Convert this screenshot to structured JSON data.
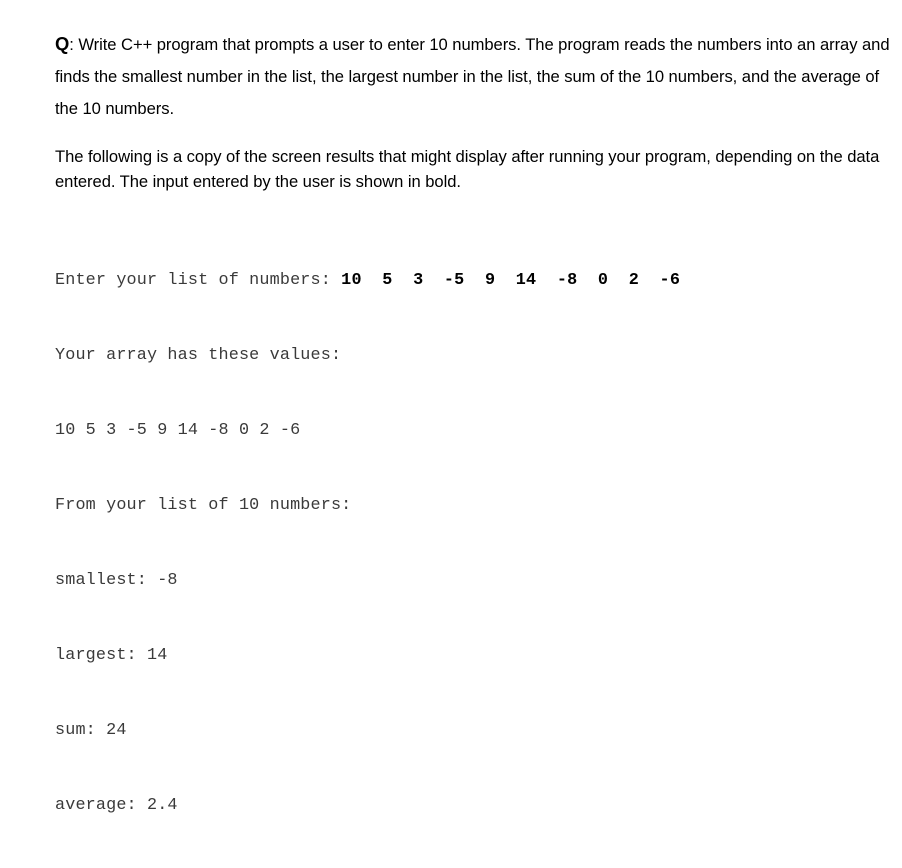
{
  "document": {
    "background_color": "#ffffff",
    "text_color": "#000000",
    "console_text_color": "#3a3a3a"
  },
  "question": {
    "label": "Q",
    "separator": ": ",
    "body": "Write C++ program that prompts a user to enter 10 numbers. The program reads the numbers into an array and finds the smallest number in the list, the largest number in the list, the sum of the 10 numbers, and the average of the 10 numbers."
  },
  "intro": {
    "text": "The following is a copy of the screen results that might display after running your program, depending on the data entered. The input entered by the user is shown in bold."
  },
  "console": {
    "prompt_line": {
      "prompt": "Enter your list of numbers: ",
      "user_input": "10  5  3  -5  9  14  -8  0  2  -6"
    },
    "lines": [
      "Your array has these values:",
      "10 5 3 -5 9 14 -8 0 2 -6",
      "From your list of 10 numbers:",
      "smallest: -8",
      "largest: 14",
      "sum: 24",
      "average: 2.4"
    ]
  }
}
